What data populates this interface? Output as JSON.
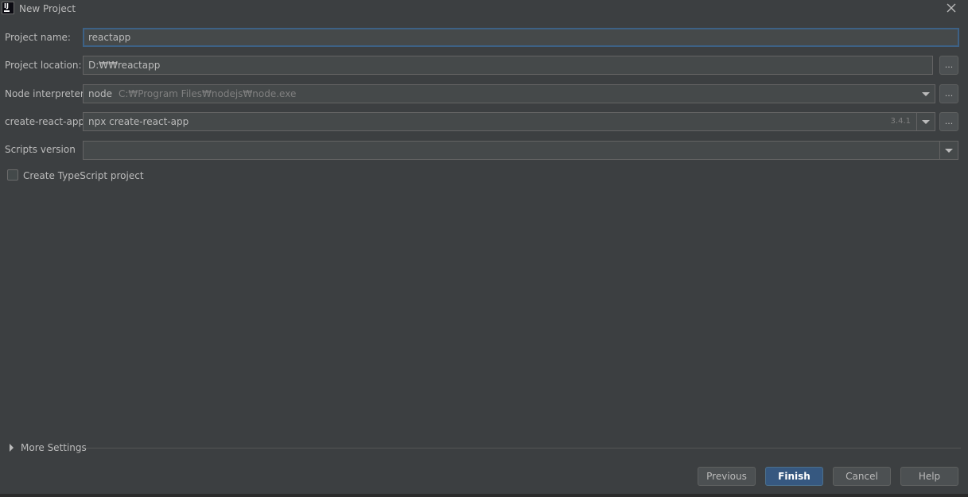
{
  "window": {
    "title": "New Project",
    "logo_text": "IJ"
  },
  "form": {
    "project_name": {
      "label": "Project name:",
      "value": "reactapp"
    },
    "project_location": {
      "label": "Project location:",
      "value": "D:₩₩reactapp",
      "browse_label": "..."
    },
    "node_interpreter": {
      "label": "Node interpreter:",
      "value": "node",
      "path": "C:₩Program Files₩nodejs₩node.exe",
      "browse_label": "..."
    },
    "create_react_app": {
      "label": "create-react-app:",
      "value": "npx create-react-app",
      "version": "3.4.1",
      "browse_label": "..."
    },
    "scripts_version": {
      "label": "Scripts version",
      "value": ""
    },
    "typescript_checkbox": {
      "label": "Create TypeScript project",
      "checked": false
    }
  },
  "more_settings": {
    "label": "More Settings",
    "expanded": false
  },
  "buttons": {
    "previous": "Previous",
    "finish": "Finish",
    "cancel": "Cancel",
    "help": "Help"
  },
  "colors": {
    "background": "#3c3f41",
    "field_bg": "#45494a",
    "focus_border": "#3d6185",
    "primary_button": "#365880",
    "text": "#bbbbbb"
  }
}
